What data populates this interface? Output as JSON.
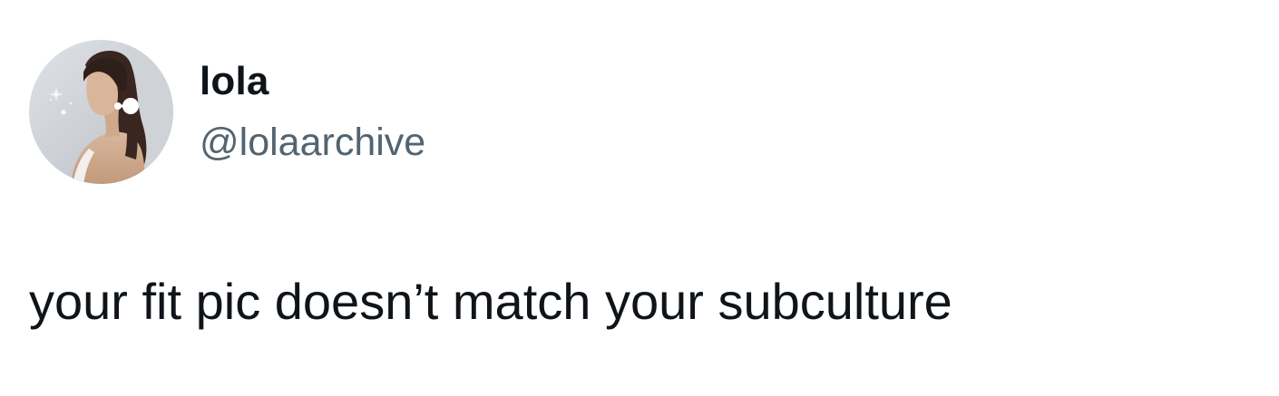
{
  "tweet": {
    "author": {
      "display_name": "lola",
      "handle": "@lolaarchive",
      "avatar_icon": "profile-photo"
    },
    "text": "your fit pic doesn’t match your subculture"
  },
  "colors": {
    "background": "#ffffff",
    "primary_text": "#0f1419",
    "secondary_text": "#536471"
  }
}
